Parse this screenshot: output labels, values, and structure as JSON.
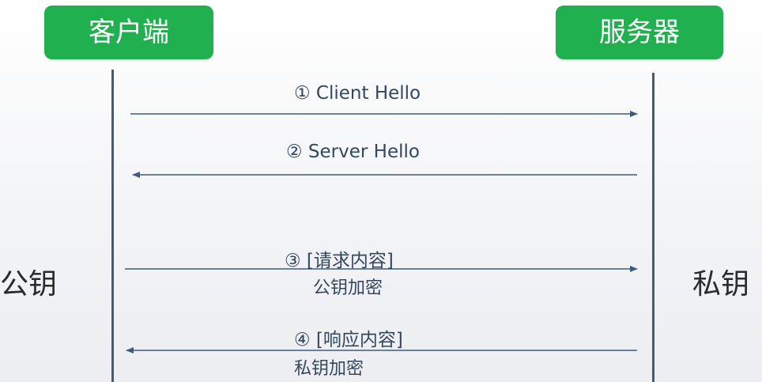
{
  "client": {
    "label": "客户端"
  },
  "server": {
    "label": "服务器"
  },
  "client_side_key": "公钥",
  "server_side_key": "私钥",
  "messages": [
    {
      "title": "① Client Hello",
      "direction": "client-to-server"
    },
    {
      "title": "② Server Hello",
      "direction": "server-to-client"
    },
    {
      "title": "③ [请求内容]",
      "note": "公钥加密",
      "direction": "client-to-server"
    },
    {
      "title": "④ [响应内容]",
      "note": "私钥加密",
      "direction": "server-to-client"
    }
  ],
  "colors": {
    "pill": "#20b04f",
    "line": "#3f5c7a"
  }
}
